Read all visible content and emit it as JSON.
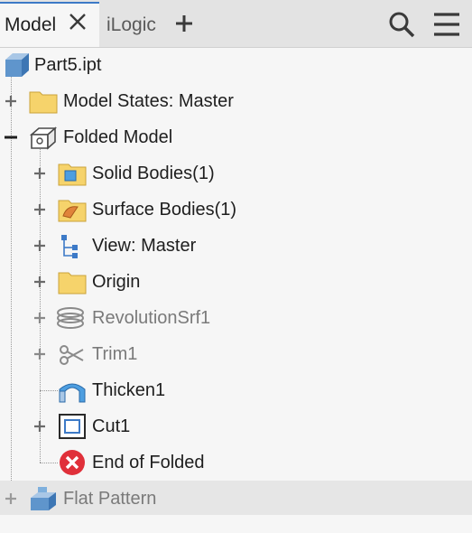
{
  "tabs": {
    "active_label": "Model",
    "inactive_label": "iLogic"
  },
  "icons": {
    "close": "close-icon",
    "add": "plus-icon",
    "search": "search-icon",
    "menu": "hamburger-menu-icon"
  },
  "tree": {
    "root": {
      "label": "Part5.ipt"
    },
    "items": [
      {
        "label": "Model States: Master"
      },
      {
        "label": "Folded Model"
      },
      {
        "label": "Solid Bodies(1)"
      },
      {
        "label": "Surface Bodies(1)"
      },
      {
        "label": "View: Master"
      },
      {
        "label": "Origin"
      },
      {
        "label": "RevolutionSrf1"
      },
      {
        "label": "Trim1"
      },
      {
        "label": "Thicken1"
      },
      {
        "label": "Cut1"
      },
      {
        "label": "End of Folded"
      },
      {
        "label": "Flat Pattern"
      }
    ]
  },
  "colors": {
    "accent": "#3d7ac7",
    "folder": "#f6d36b",
    "error": "#e0303a"
  }
}
